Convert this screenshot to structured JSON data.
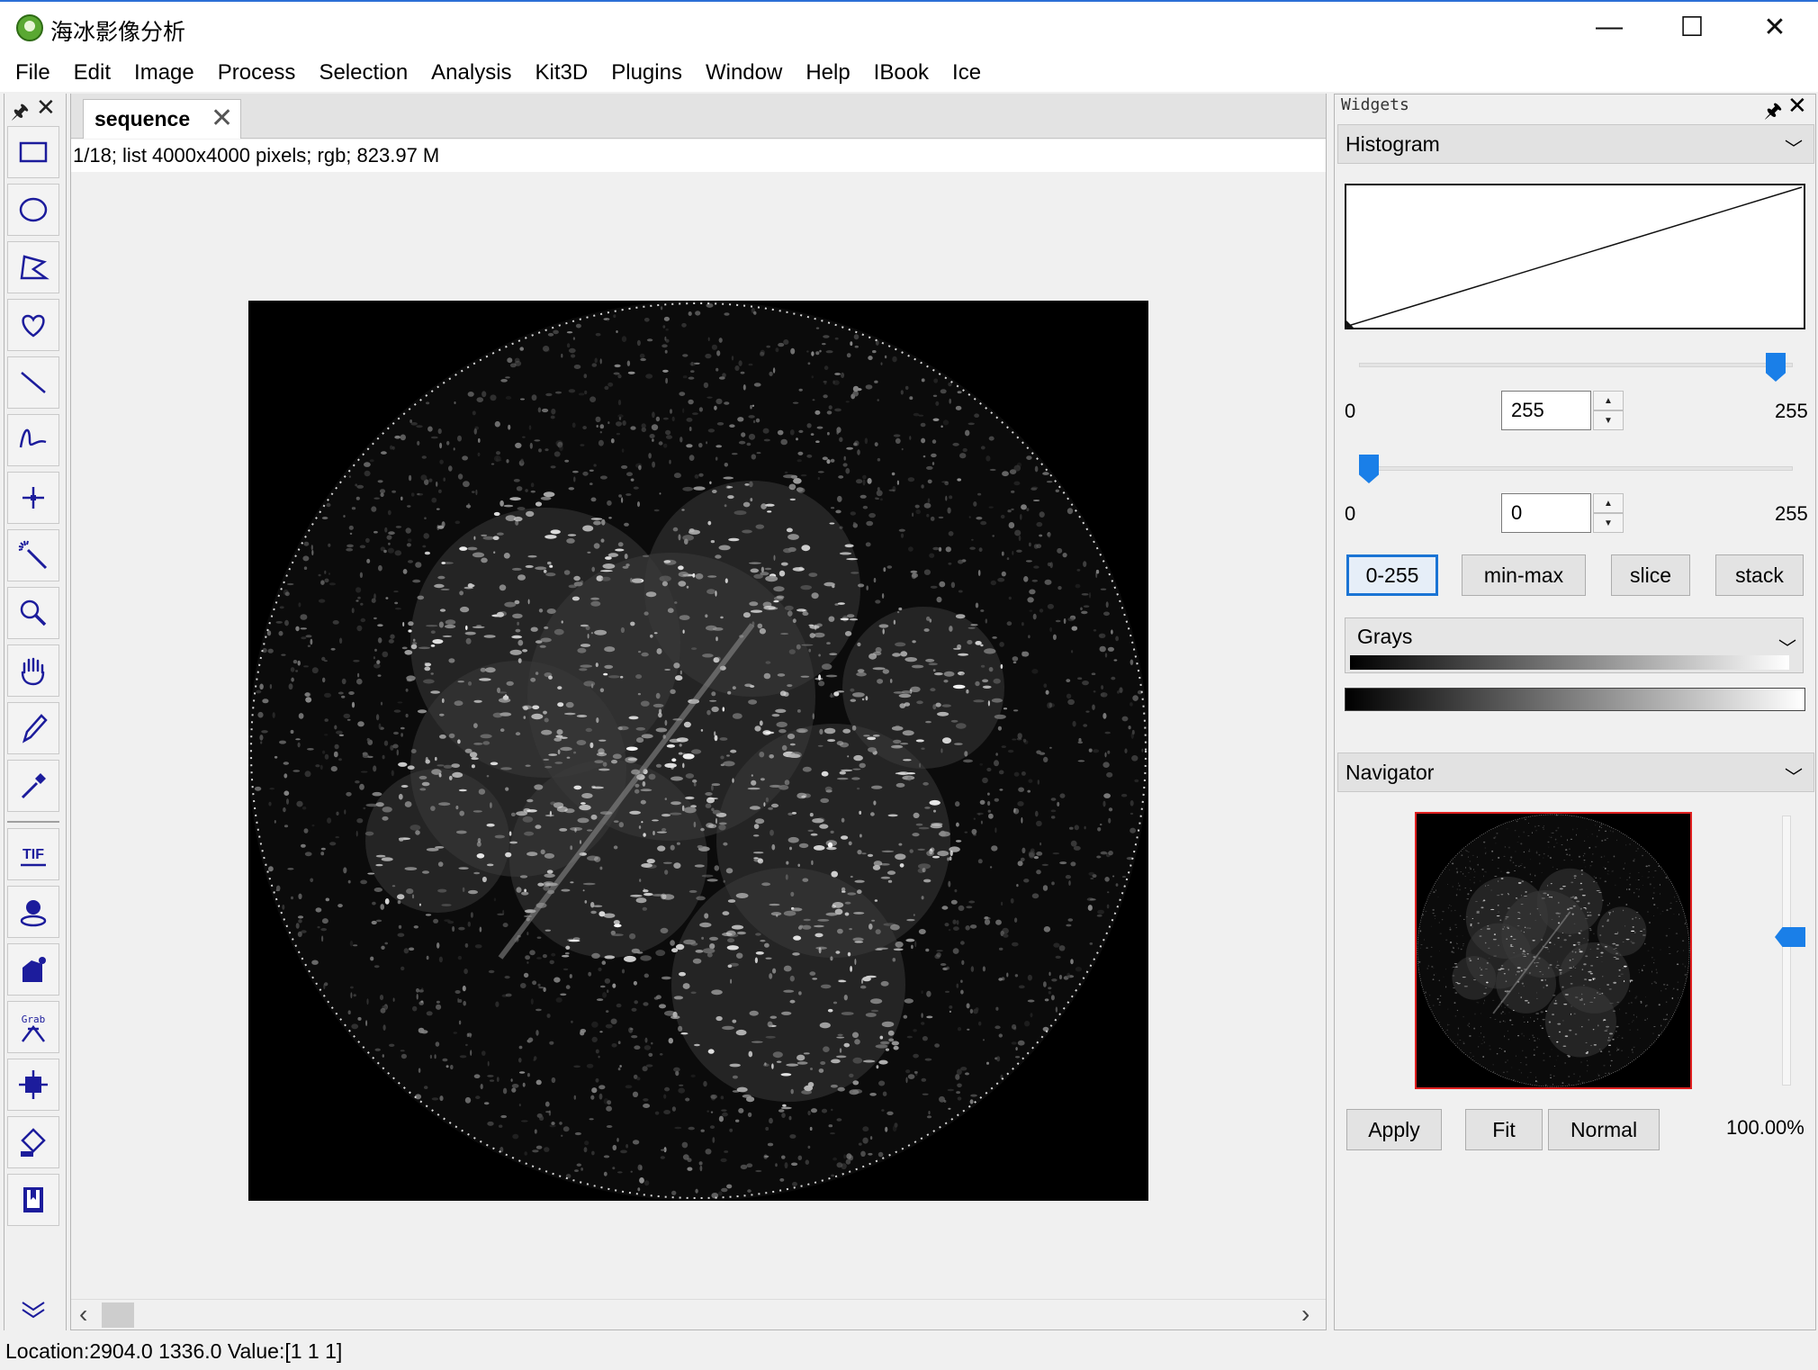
{
  "window": {
    "title": "海冰影像分析",
    "controls": {
      "minimize": "—",
      "maximize": "☐",
      "close": "✕"
    }
  },
  "menu": [
    "File",
    "Edit",
    "Image",
    "Process",
    "Selection",
    "Analysis",
    "Kit3D",
    "Plugins",
    "Window",
    "Help",
    "IBook",
    "Ice"
  ],
  "toolbar": {
    "pin": "🖈",
    "close": "✕",
    "tools": [
      "rectangle-select-icon",
      "oval-select-icon",
      "polygon-select-icon",
      "freehand-select-icon",
      "line-tool-icon",
      "curve-tool-icon",
      "point-tool-icon",
      "magic-wand-icon",
      "zoom-icon",
      "hand-pan-icon",
      "pencil-icon",
      "eyedropper-icon",
      "tif-export-icon",
      "blob-detect-icon",
      "floodfill-icon",
      "grab-icon",
      "crop-center-icon",
      "paint-bucket-icon",
      "book-icon",
      "expand-more-icon"
    ],
    "grab_text": "Grab",
    "tif_text": "TIF"
  },
  "document": {
    "tab_label": "sequence",
    "tab_close": "✕",
    "info": "1/18; list  4000x4000 pixels; rgb; 823.97 M",
    "scroll_left": "‹",
    "scroll_right": "›"
  },
  "statusbar": {
    "text": "Location:2904.0 1336.0  Value:[1 1 1]"
  },
  "widgets": {
    "title": "Widgets",
    "pin": "🖈",
    "close": "✕",
    "histogram": {
      "header": "Histogram",
      "max_slider": {
        "min_label": "0",
        "value": "255",
        "max_label": "255",
        "level": 1.0
      },
      "min_slider": {
        "min_label": "0",
        "value": "0",
        "max_label": "255",
        "level": 0.0
      },
      "buttons": [
        "0-255",
        "min-max",
        "slice",
        "stack"
      ],
      "lut": "Grays"
    },
    "navigator": {
      "header": "Navigator",
      "buttons": [
        "Apply",
        "Fit",
        "Normal"
      ],
      "zoom": "100.00%"
    }
  },
  "colors": {
    "accent": "#1a7fe8",
    "nav_border": "#e02020",
    "title_border": "#2b6fd6"
  }
}
